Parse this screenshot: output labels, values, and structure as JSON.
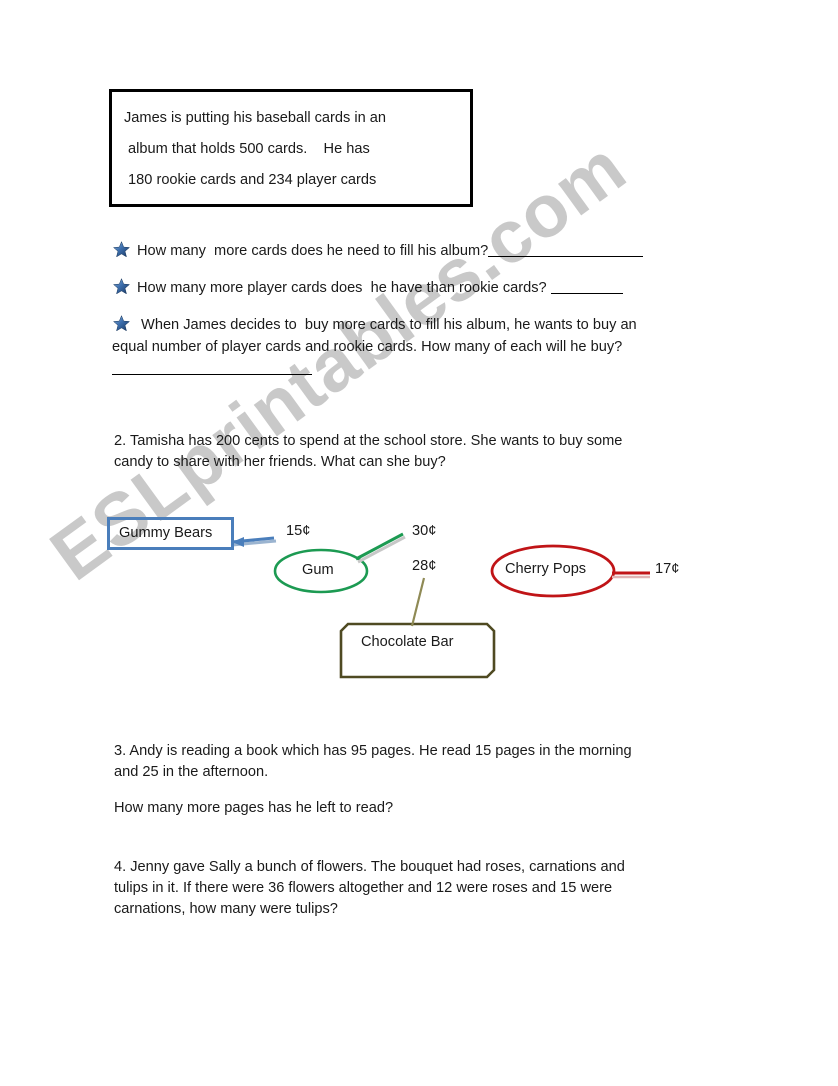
{
  "document": {
    "watermark": "ESLprintables.com"
  },
  "problem1": {
    "story_lines": [
      "James is putting his baseball cards in an",
      " album that holds 500 cards.    He has",
      " 180 rookie cards and 234 player cards"
    ],
    "questions": [
      {
        "bullet": "star-icon",
        "text": "How many  more cards does he need to fill his album?"
      },
      {
        "bullet": "star-icon",
        "text": "How many more player cards does  he have than rookie cards? "
      },
      {
        "bullet": "star-icon",
        "line1": " When James decides to  buy more cards to fill his album, he wants to buy an",
        "line2": "equal number of player cards and rookie cards.   How many of each will he buy?"
      }
    ]
  },
  "problem2": {
    "text": "2. Tamisha has 200 cents to spend at the school store.  She wants to buy some\ncandy to share with her friends.  What can she buy?",
    "items": [
      {
        "name": "Gummy Bears",
        "price": "15¢",
        "shape": "rectangle",
        "color": "#4a7ebb"
      },
      {
        "name": "Gum",
        "price": "30¢",
        "shape": "ellipse",
        "color": "#1c9a52"
      },
      {
        "name": "Chocolate Bar",
        "price": "28¢",
        "shape": "beveled-rectangle",
        "color": "#4f4a22"
      },
      {
        "name": "Cherry Pops",
        "price": "17¢",
        "shape": "ellipse",
        "color": "#c01417"
      }
    ]
  },
  "problem3": {
    "text": "3. Andy is reading a book which has 95 pages.  He read 15 pages in the morning\nand 25 in the afternoon.",
    "followup": "How many more pages has he left to read?"
  },
  "problem4": {
    "text": "4. Jenny gave Sally a bunch of flowers. The bouquet had roses, carnations and\ntulips in it. If there were 36 flowers altogether and 12 were roses and 15 were\ncarnations, how many were tulips?"
  }
}
